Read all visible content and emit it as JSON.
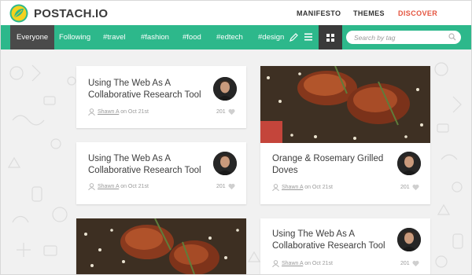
{
  "brand": {
    "name": "POSTACH.IO",
    "color": "#2db88b"
  },
  "top_nav": [
    {
      "label": "MANIFESTO"
    },
    {
      "label": "THEMES"
    },
    {
      "label": "DISCOVER",
      "color": "#e4543f"
    }
  ],
  "tags": [
    "Everyone",
    "Following",
    "#travel",
    "#fashion",
    "#food",
    "#edtech",
    "#design"
  ],
  "toolbar_icons": [
    "pencil-icon",
    "list-view-icon",
    "grid-view-icon"
  ],
  "search": {
    "placeholder": "Search by tag"
  },
  "cards": [
    {
      "title_line1": "Using The Web As A",
      "title_line2": "Collaborative Research Tool",
      "author": "Shawn A",
      "date_text": " on Oct 21st",
      "likes": "201"
    },
    {
      "title_line1": "Using The Web As A",
      "title_line2": "Collaborative Research Tool",
      "author": "Shawn A",
      "date_text": " on Oct 21st",
      "likes": "201"
    },
    {
      "title_line1": "Orange & Rosemary Grilled",
      "title_line2": "Doves",
      "author": "Shawn A",
      "date_text": " on Oct 21st",
      "likes": "201"
    },
    {
      "title_line1": "Using The Web As A",
      "title_line2": "Collaborative Research Tool",
      "author": "Shawn A",
      "date_text": " on Oct 21st",
      "likes": "201"
    }
  ]
}
